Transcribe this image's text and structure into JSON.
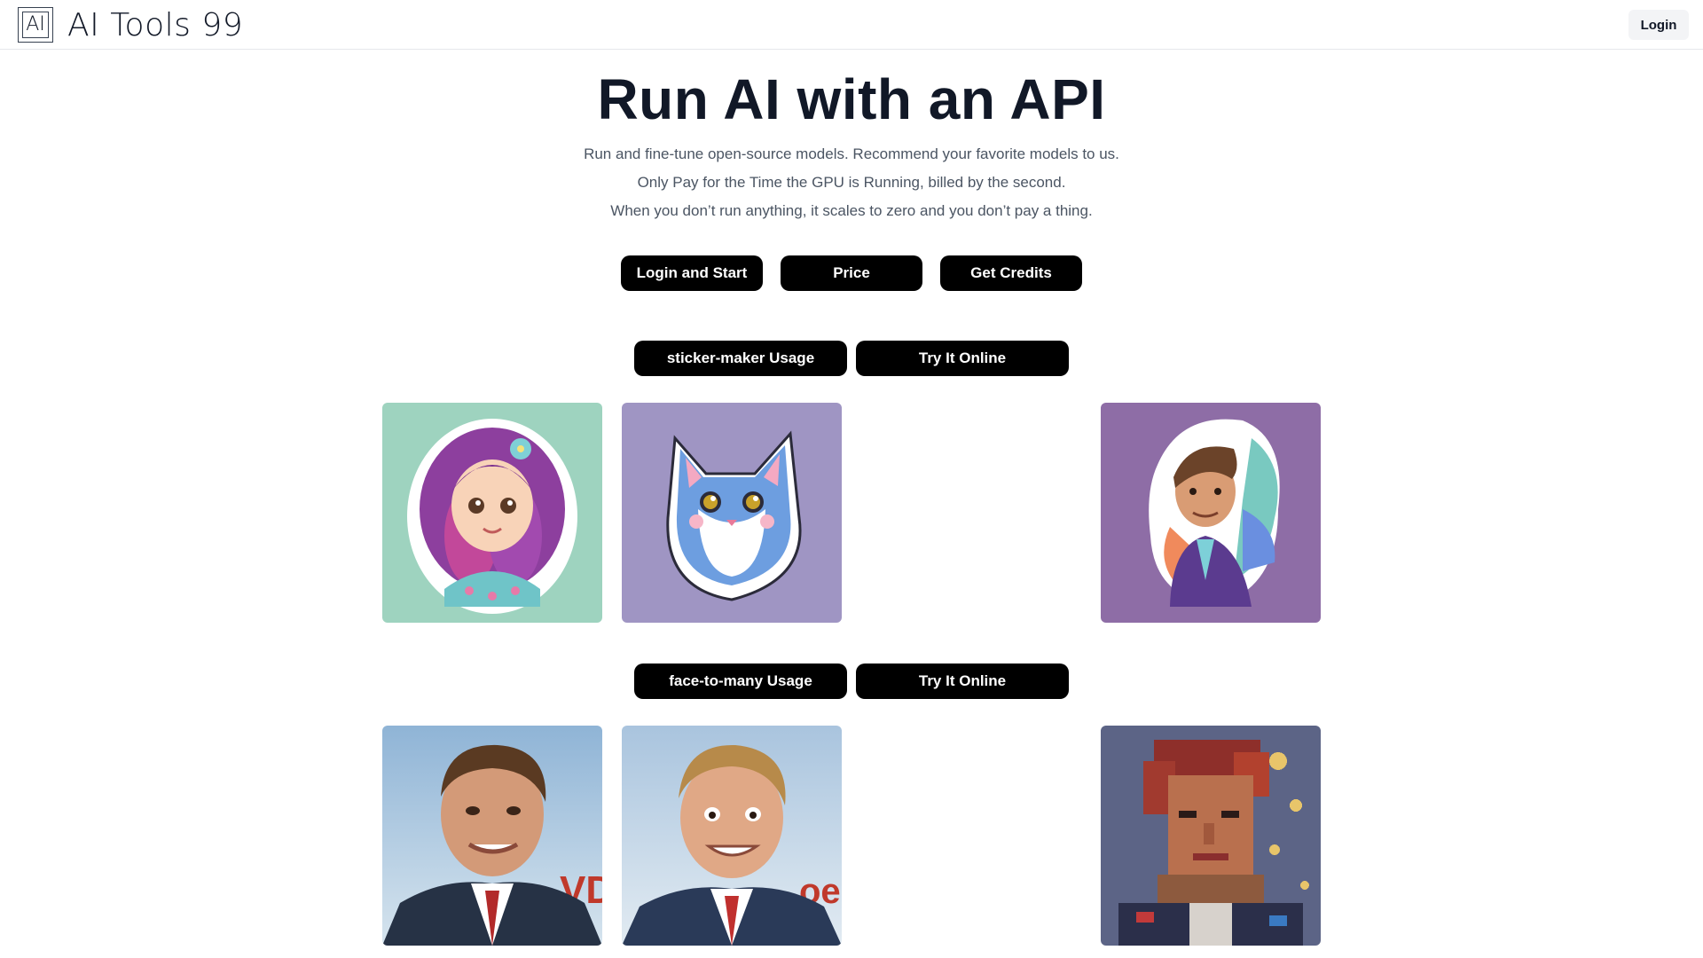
{
  "header": {
    "logo_text": "AI",
    "brand_name": "AI Tools 99",
    "login_label": "Login"
  },
  "hero": {
    "title": "Run AI with an API",
    "lines": [
      "Run and fine-tune open-source models. Recommend your favorite models to us.",
      "Only Pay for the Time the GPU is Running, billed by the second.",
      "When you don’t run anything, it scales to zero and you don’t pay a thing."
    ],
    "buttons": {
      "login_start": "Login and Start",
      "price": "Price",
      "credits": "Get Credits"
    }
  },
  "sections": [
    {
      "usage_label": "sticker-maker Usage",
      "try_label": "Try It Online",
      "images": [
        {
          "icon": "girl-sticker-image",
          "bg": "#9ed3bf"
        },
        {
          "icon": "cat-sticker-image",
          "bg": "#9f95c3"
        },
        {
          "icon": "man-sticker-image",
          "bg": "#8e6da6"
        }
      ]
    },
    {
      "usage_label": "face-to-many Usage",
      "try_label": "Try It Online",
      "images": [
        {
          "icon": "man-portrait-3d-image",
          "bg": "#b9d3e6"
        },
        {
          "icon": "man-portrait-cartoon-image",
          "bg": "#c3d4e3"
        },
        {
          "icon": "pixel-art-portrait-image",
          "bg": "#6a6f8e"
        }
      ]
    }
  ]
}
